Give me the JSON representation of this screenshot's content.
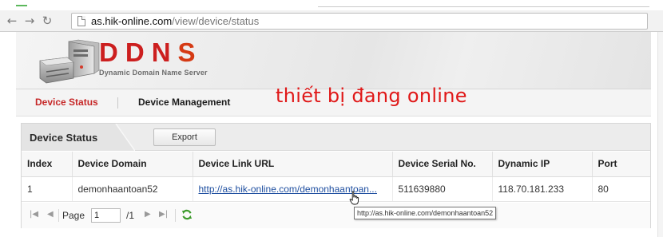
{
  "browser": {
    "back_icon": "arrow-left-icon",
    "forward_icon": "arrow-right-icon",
    "reload_icon": "reload-icon",
    "page_icon": "page-icon",
    "url_host": "as.hik-online.com",
    "url_path": "/view/device/status"
  },
  "header": {
    "logo_letters": [
      "D",
      "D",
      "N",
      "S"
    ],
    "tagline": "Dynamic Domain Name Server",
    "server_icon": "server-icon"
  },
  "nav": {
    "tabs": [
      {
        "label": "Device Status",
        "active": true
      },
      {
        "label": "Device Management",
        "active": false
      }
    ]
  },
  "overlay_note": "thiết bị đang online",
  "panel": {
    "title": "Device Status",
    "export_label": "Export",
    "columns": [
      "Index",
      "Device Domain",
      "Device Link URL",
      "Device Serial No.",
      "Dynamic IP",
      "Port"
    ],
    "rows": [
      {
        "index": "1",
        "domain": "demonhaantoan52",
        "link": "http://as.hik-online.com/demonhaantoan...",
        "serial": "511639880",
        "ip": "118.70.181.233",
        "port": "80"
      }
    ],
    "pager": {
      "page_label": "Page",
      "page_value": "1",
      "total": "/1",
      "first_icon": "first-page-icon",
      "prev_icon": "prev-page-icon",
      "next_icon": "next-page-icon",
      "last_icon": "last-page-icon",
      "refresh_icon": "refresh-icon"
    }
  },
  "tooltip": "http://as.hik-online.com/demonhaantoan52",
  "colors": {
    "accent_red": "#c62828",
    "logo_red": "#cc1f1f",
    "overlay_red": "#e01818",
    "link_blue": "#1f4fa0"
  }
}
